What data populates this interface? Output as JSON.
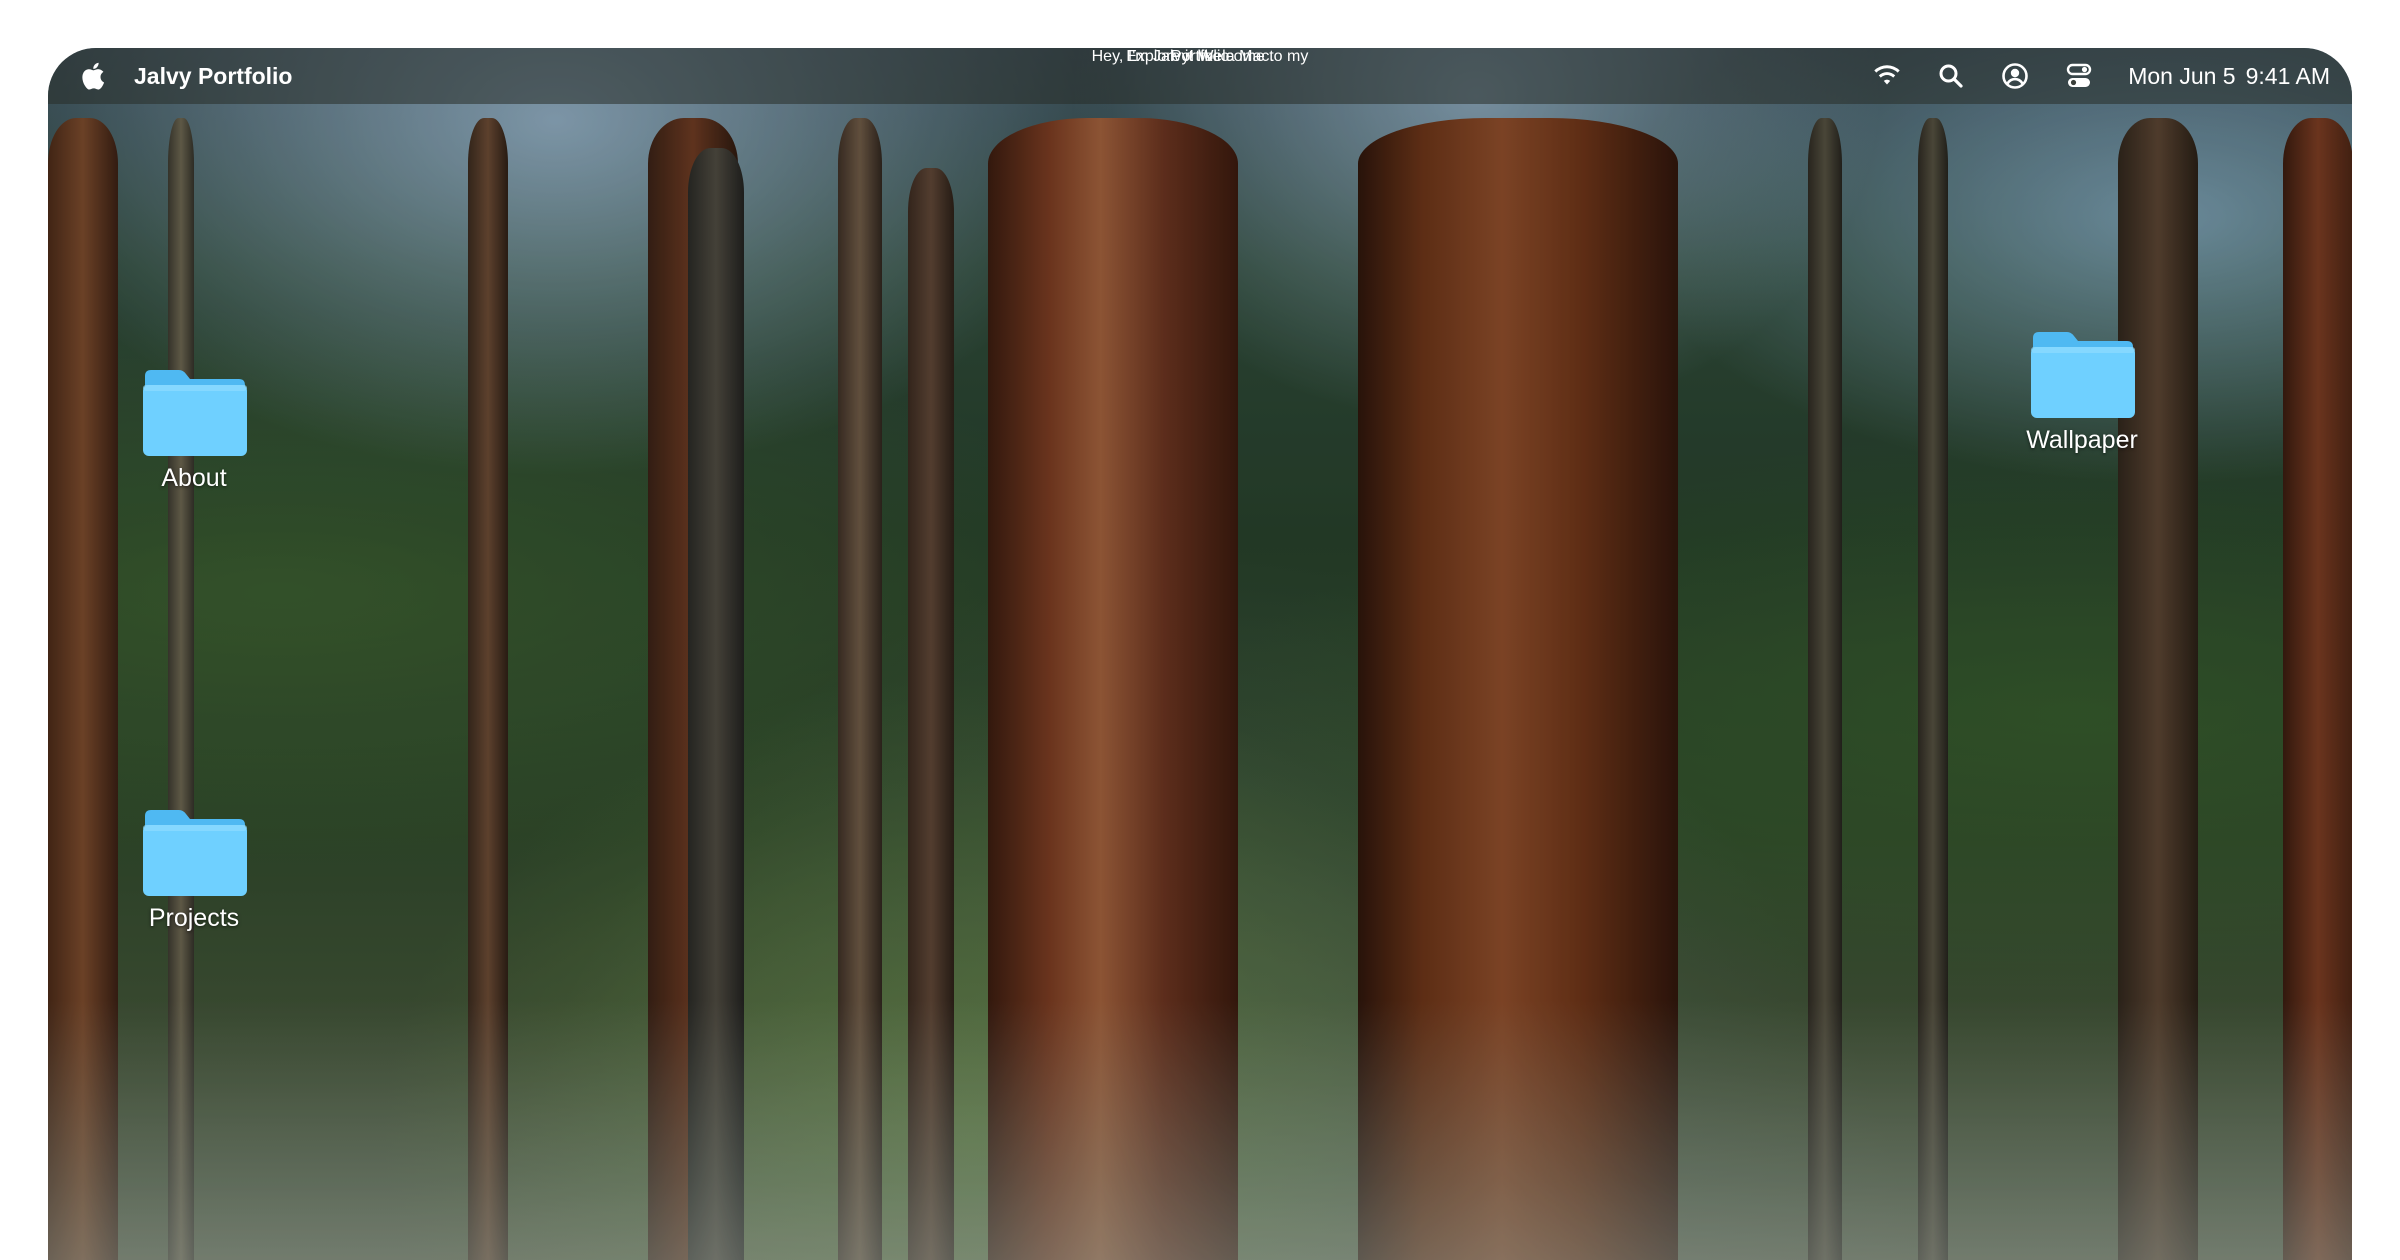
{
  "menubar": {
    "app_name": "Jalvy Portfolio",
    "date": "Mon Jun 5",
    "time": "9:41 AM",
    "icons": [
      "apple-icon",
      "wifi-icon",
      "search-icon",
      "user-icon",
      "control-center-icon"
    ]
  },
  "desktop": {
    "icons": [
      {
        "label": "About",
        "icon": "folder-icon"
      },
      {
        "label": "Projects",
        "icon": "folder-icon"
      },
      {
        "label": "Wallpaper",
        "icon": "folder-icon"
      }
    ]
  },
  "hero": {
    "greeting": "Hey, I'm Jalvy! Welcome to my",
    "title": "Portfolio",
    "tagline": "Explore it like a Mac."
  },
  "colors": {
    "folder_top": "#5cc4f8",
    "folder_body": "#6fd0ff",
    "text": "#ffffff"
  }
}
